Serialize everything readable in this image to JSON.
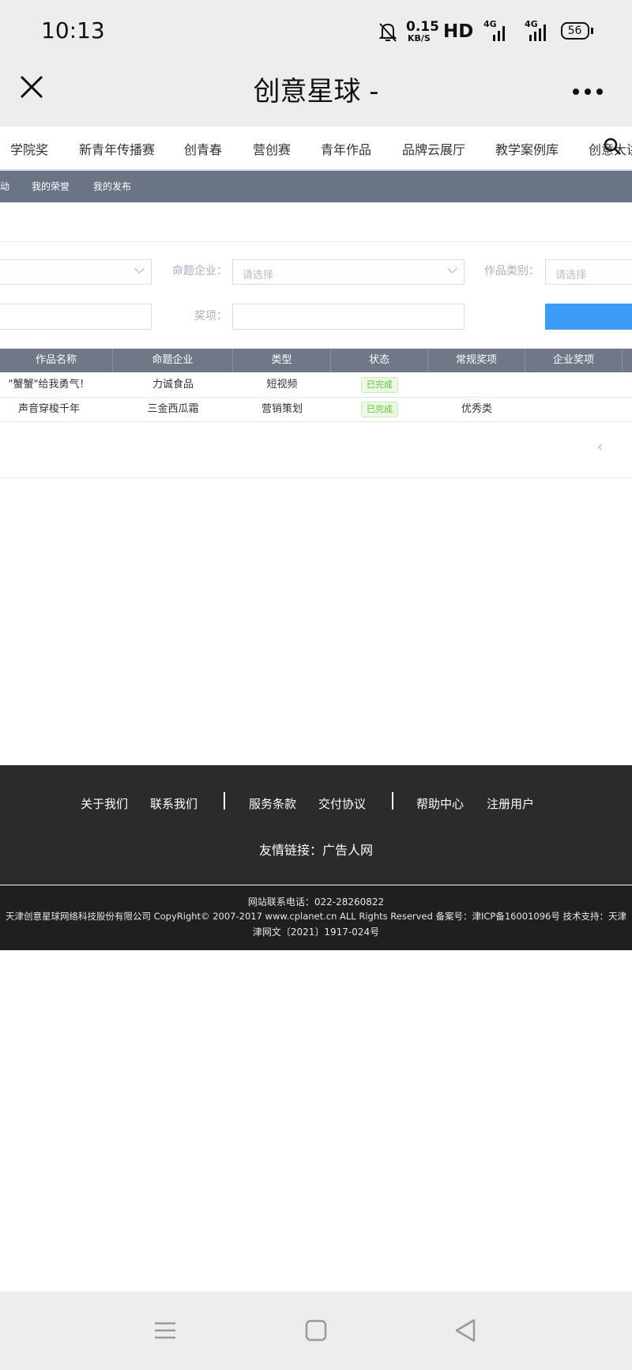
{
  "status_bar": {
    "time": "10:13",
    "speed_value": "0.15",
    "speed_unit": "KB/S",
    "hd_label": "HD",
    "sim1_label": "4G",
    "sim2_label": "4G",
    "battery": "56",
    "icons": [
      "mute-bell-icon",
      "signal-icon",
      "battery-icon"
    ]
  },
  "title_bar": {
    "title": "创意星球 -",
    "icons": [
      "close-icon",
      "more-icon"
    ]
  },
  "nav": {
    "items": [
      "学院奖",
      "新青年传播赛",
      "创青春",
      "营创赛",
      "青年作品",
      "品牌云展厅",
      "教学案例库",
      "创意大讲"
    ],
    "icons": [
      "search-icon"
    ]
  },
  "subnav": {
    "items": [
      "动",
      "我的荣誉",
      "我的发布"
    ]
  },
  "filters": {
    "company_label": "命题企业：",
    "company_placeholder": "请选择",
    "category_label": "作品类别：",
    "category_placeholder": "请选择",
    "award_label": "奖项："
  },
  "table": {
    "headers": [
      "作品名称",
      "命题企业",
      "类型",
      "状态",
      "常规奖项",
      "企业奖项"
    ],
    "rows": [
      {
        "name": "\"蟹蟹\"给我勇气！",
        "company": "力诚食品",
        "type": "短视频",
        "status": "已完成",
        "regular_award": "",
        "company_award": ""
      },
      {
        "name": "声音穿梭千年",
        "company": "三金西瓜霜",
        "type": "营销策划",
        "status": "已完成",
        "regular_award": "优秀类",
        "company_award": ""
      }
    ]
  },
  "pager": {
    "prev": "‹"
  },
  "footer": {
    "links": [
      "关于我们",
      "联系我们",
      "服务条款",
      "交付协议",
      "帮助中心",
      "注册用户"
    ],
    "friend_links": "友情链接：广告人网",
    "phone": "网站联系电话：022-28260822",
    "copyright": "天津创意星球网络科技股份有限公司 CopyRight© 2007-2017 www.cplanet.cn ALL Rights Reserved 备案号：津ICP备16001096号 技术支持：天津",
    "license": "津网文〔2021〕1917-024号"
  },
  "android_nav": {
    "icons": [
      "menu-icon",
      "home-icon",
      "back-icon"
    ]
  }
}
